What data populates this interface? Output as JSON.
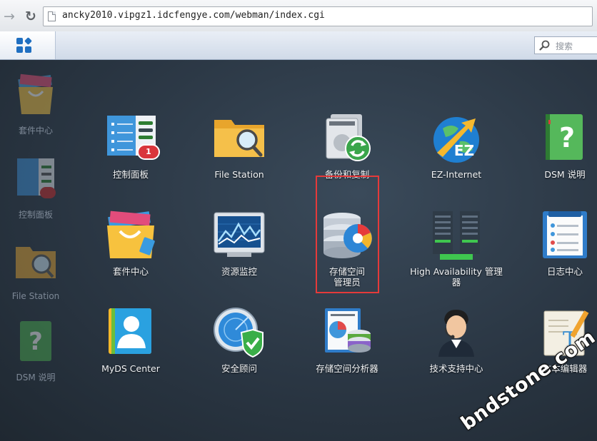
{
  "browser": {
    "url": "ancky2010.vipgz1.idcfengye.com/webman/index.cgi",
    "back_icon": "back-arrow-icon",
    "reload_icon": "reload-icon"
  },
  "taskbar": {
    "main_menu_icon": "grid-icon",
    "search_placeholder": "搜索"
  },
  "desktop_shortcuts": [
    {
      "label": "套件中心",
      "icon": "package-center-icon"
    },
    {
      "label": "控制面板",
      "icon": "control-panel-icon",
      "badge": "1"
    },
    {
      "label": "File Station",
      "icon": "folder-search-icon"
    },
    {
      "label": "DSM 说明",
      "icon": "help-book-icon"
    }
  ],
  "apps": [
    {
      "label": "控制面板",
      "icon": "control-panel-icon",
      "badge": "1"
    },
    {
      "label": "File Station",
      "icon": "folder-search-icon"
    },
    {
      "label": "备份和复制",
      "icon": "backup-sync-icon"
    },
    {
      "label": "EZ-Internet",
      "icon": "ez-internet-globe-icon"
    },
    {
      "label": "DSM 说明",
      "icon": "help-book-icon"
    },
    {
      "label": "套件中心",
      "icon": "package-center-icon"
    },
    {
      "label": "资源监控",
      "icon": "resource-monitor-icon"
    },
    {
      "label": "存储空间\n管理员",
      "icon": "storage-manager-icon"
    },
    {
      "label": "High Availability 管理\n器",
      "icon": "high-availability-icon"
    },
    {
      "label": "日志中心",
      "icon": "log-center-icon"
    },
    {
      "label": "MyDS Center",
      "icon": "myds-center-icon"
    },
    {
      "label": "安全顾问",
      "icon": "security-advisor-icon"
    },
    {
      "label": "存储空间分析器",
      "icon": "storage-analyzer-icon"
    },
    {
      "label": "技术支持中心",
      "icon": "support-center-icon"
    },
    {
      "label": "文本编辑器",
      "icon": "text-editor-icon"
    }
  ],
  "watermark": "bndstone.com",
  "colors": {
    "highlight": "#e53a3a",
    "badge": "#d9353b",
    "accent": "#1f6fc1"
  }
}
